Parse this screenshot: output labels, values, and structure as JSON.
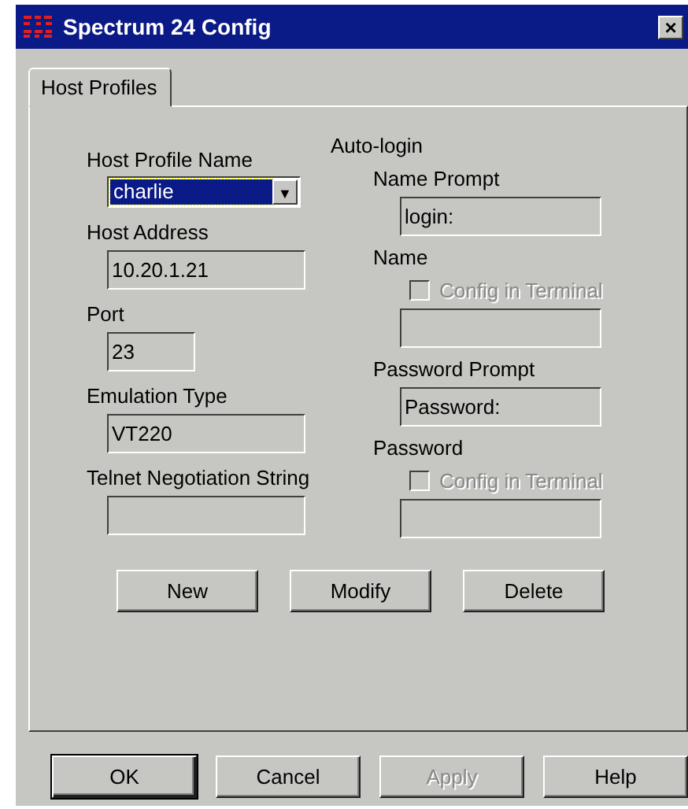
{
  "window": {
    "title": "Spectrum 24 Config",
    "close_label": "×"
  },
  "tabs": [
    {
      "label": "Host Profiles",
      "selected": true
    }
  ],
  "left": {
    "profile": {
      "label": "Host Profile Name",
      "value": "charlie",
      "focused": true,
      "arrow": "▼"
    },
    "fields": [
      {
        "label": "Host Address",
        "value": "10.20.1.21",
        "kind": "wide"
      },
      {
        "label": "Port",
        "value": "23",
        "kind": "narrow"
      },
      {
        "label": "Emulation Type",
        "value": "VT220",
        "kind": "wide"
      },
      {
        "label": "Telnet Negotiation String",
        "kind": "wide"
      }
    ]
  },
  "auto_login": {
    "title": "Auto-login",
    "items": [
      {
        "kind": "field",
        "label": "Name Prompt",
        "value": "login:"
      },
      {
        "kind": "label",
        "label": "Name"
      },
      {
        "kind": "checkbox",
        "label": "Config in Terminal",
        "checked": false,
        "disabled": true
      },
      {
        "kind": "field"
      },
      {
        "kind": "field",
        "label": "Password Prompt",
        "value": "Password:"
      },
      {
        "kind": "label",
        "label": "Password"
      },
      {
        "kind": "checkbox",
        "label": "Config in Terminal",
        "checked": false,
        "disabled": true
      },
      {
        "kind": "field"
      }
    ]
  },
  "profile_buttons": [
    {
      "label": "New",
      "disabled": false
    },
    {
      "label": "Modify",
      "disabled": false
    },
    {
      "label": "Delete",
      "disabled": false
    }
  ],
  "dialog_buttons": [
    {
      "label": "OK",
      "default": true,
      "disabled": false
    },
    {
      "label": "Cancel",
      "default": false,
      "disabled": false
    },
    {
      "label": "Apply",
      "default": false,
      "disabled": true
    },
    {
      "label": "Help",
      "default": false,
      "disabled": false
    }
  ]
}
